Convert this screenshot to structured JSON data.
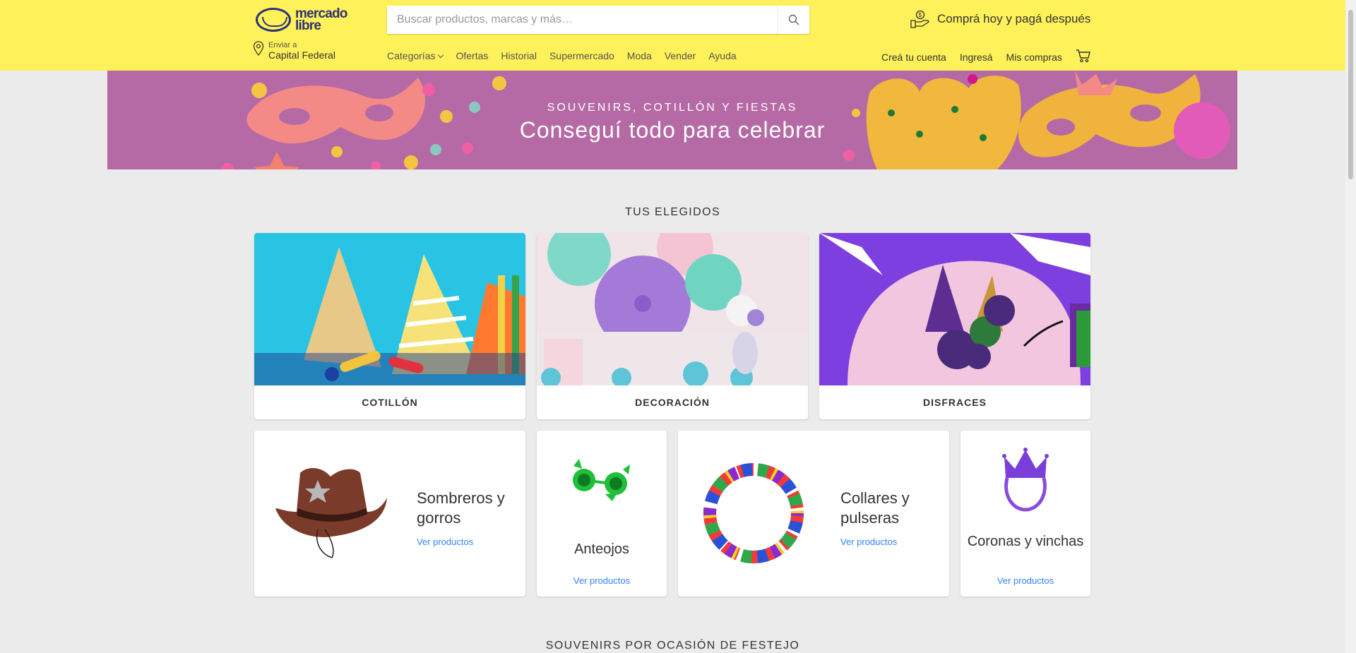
{
  "header": {
    "logo_text_line1": "mercado",
    "logo_text_line2": "libre",
    "search_placeholder": "Buscar productos, marcas y más…",
    "promo_text": "Comprá hoy y pagá después",
    "location_label": "Enviar a",
    "location_value": "Capital Federal",
    "nav": [
      "Categorías",
      "Ofertas",
      "Historial",
      "Supermercado",
      "Moda",
      "Vender",
      "Ayuda"
    ],
    "user_nav": [
      "Creá tu cuenta",
      "Ingresá",
      "Mis compras"
    ]
  },
  "banner": {
    "subtitle": "SOUVENIRS, COTILLÓN Y FIESTAS",
    "title": "Conseguí todo para celebrar",
    "bg_color": "#b56aa6"
  },
  "favorites": {
    "title": "TUS ELEGIDOS",
    "cards": [
      {
        "label": "COTILLÓN"
      },
      {
        "label": "DECORACIÓN"
      },
      {
        "label": "DISFRACES"
      }
    ]
  },
  "products": {
    "link_text": "Ver productos",
    "items": [
      {
        "title": "Sombreros y gorros"
      },
      {
        "title": "Anteojos"
      },
      {
        "title": "Collares y pulseras"
      },
      {
        "title": "Coronas y vinchas"
      }
    ]
  },
  "next_section": {
    "title": "SOUVENIRS POR OCASIÓN DE FESTEJO"
  },
  "colors": {
    "header_bg": "#fff159",
    "link": "#3483fa",
    "brand_dark": "#2d3277"
  }
}
